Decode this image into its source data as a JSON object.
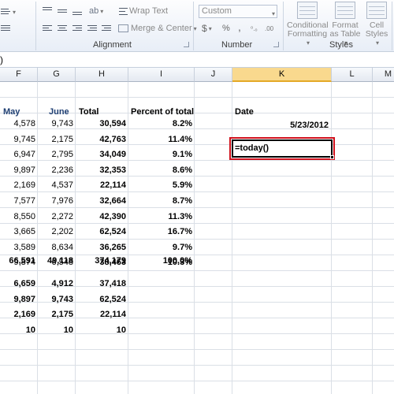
{
  "ribbon": {
    "wrap_text": "Wrap Text",
    "merge_center": "Merge & Center",
    "alignment_label": "Alignment",
    "number_format": "Custom",
    "currency_symbol": "$",
    "percent_symbol": "%",
    "comma_symbol": ",",
    "dec_inc": "⁰.₀",
    "dec_dec": ".00",
    "number_label": "Number",
    "conditional_formatting": [
      "Conditional",
      "Formatting"
    ],
    "format_as_table": [
      "Format",
      "as Table"
    ],
    "cell_styles": [
      "Cell",
      "Styles"
    ],
    "styles_label": "Styles"
  },
  "formula_bar": {
    "visible_text": ")"
  },
  "columns": [
    "F",
    "G",
    "H",
    "I",
    "J",
    "K",
    "L",
    "M"
  ],
  "selected_column": "K",
  "table": {
    "headers": {
      "may": "May",
      "june": "June",
      "total": "Total",
      "percent": "Percent of total"
    },
    "rows": [
      {
        "may": "4,578",
        "june": "9,743",
        "total": "30,594",
        "percent": "8.2%"
      },
      {
        "may": "9,745",
        "june": "2,175",
        "total": "42,763",
        "percent": "11.4%"
      },
      {
        "may": "6,947",
        "june": "2,795",
        "total": "34,049",
        "percent": "9.1%"
      },
      {
        "may": "9,897",
        "june": "2,236",
        "total": "32,353",
        "percent": "8.6%"
      },
      {
        "may": "2,169",
        "june": "4,537",
        "total": "22,114",
        "percent": "5.9%"
      },
      {
        "may": "7,577",
        "june": "7,976",
        "total": "32,664",
        "percent": "8.7%"
      },
      {
        "may": "8,550",
        "june": "2,272",
        "total": "42,390",
        "percent": "11.3%"
      },
      {
        "may": "3,665",
        "june": "2,202",
        "total": "62,524",
        "percent": "16.7%"
      },
      {
        "may": "3,589",
        "june": "8,634",
        "total": "36,265",
        "percent": "9.7%"
      },
      {
        "may": "9,874",
        "june": "6,548",
        "total": "38,463",
        "percent": "10.3%"
      }
    ],
    "total_row": {
      "may": "66,591",
      "june": "49,118",
      "total": "374,179",
      "percent": "100.0%"
    },
    "stat_rows": [
      {
        "may": "6,659",
        "june": "4,912",
        "total": "37,418"
      },
      {
        "may": "9,897",
        "june": "9,743",
        "total": "62,524"
      },
      {
        "may": "2,169",
        "june": "2,175",
        "total": "22,114"
      },
      {
        "may": "10",
        "june": "10",
        "total": "10"
      }
    ]
  },
  "date_block": {
    "label": "Date",
    "value": "5/23/2012",
    "formula": "=today()"
  },
  "colors": {
    "selected_column": "#f9d98e",
    "highlight_border": "#d0101b",
    "header_blue": "#1f3f73"
  }
}
